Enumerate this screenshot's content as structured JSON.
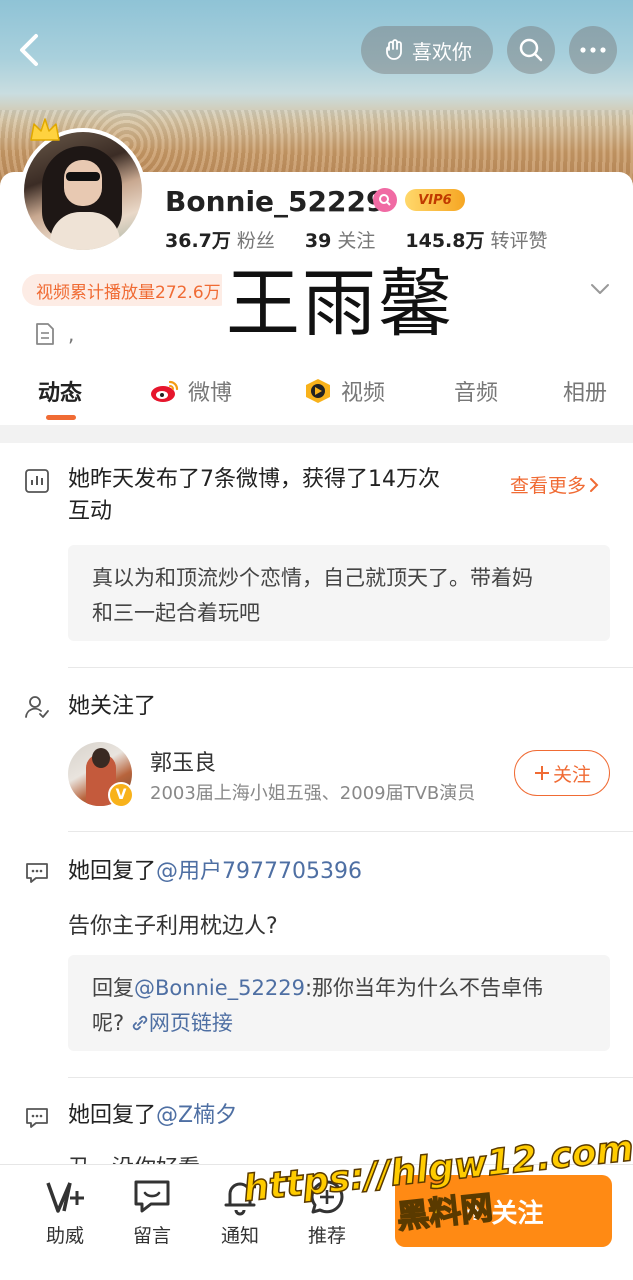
{
  "header": {
    "like_label": "喜欢你"
  },
  "profile": {
    "username": "Bonnie_52229",
    "vip_label": "VIP6",
    "stats": [
      {
        "num": "36.7万",
        "label": "粉丝"
      },
      {
        "num": "39",
        "label": "关注"
      },
      {
        "num": "145.8万",
        "label": "转评赞"
      }
    ],
    "tag": "视频累计播放量272.6万",
    "overlay_name": "王雨馨",
    "bio": ","
  },
  "tabs": [
    {
      "label": "动态",
      "active": true
    },
    {
      "label": "微博",
      "active": false
    },
    {
      "label": "视频",
      "active": false
    },
    {
      "label": "音频",
      "active": false
    },
    {
      "label": "相册",
      "active": false
    }
  ],
  "feed": {
    "summary": {
      "title_line1": "她昨天发布了7条微博，获得了14万次",
      "title_line2": "互动",
      "more_label": "查看更多",
      "quote_line1": "真以为和顶流炒个恋情，自己就顶天了。带着妈",
      "quote_line2": "和三一起合着玩吧"
    },
    "follow": {
      "title": "她关注了",
      "name": "郭玉良",
      "desc": "2003届上海小姐五强、2009届TVB演员",
      "verified_mark": "V",
      "button_label": "关注"
    },
    "reply1": {
      "prefix": "她回复了",
      "mention": "@用户7977705396",
      "text": "告你主子利用枕边人?",
      "quote_prefix": "回复",
      "quote_mention": "@Bonnie_52229",
      "quote_line1": ":那你当年为什么不告卓伟",
      "quote_line2_text": "呢?",
      "link_label": "网页链接"
    },
    "reply2": {
      "prefix": "她回复了",
      "mention": "@Z楠夕",
      "text_partial": "丑，没你好看"
    }
  },
  "bottom_nav": [
    {
      "label": "助威",
      "icon": "cheer-icon"
    },
    {
      "label": "留言",
      "icon": "message-icon"
    },
    {
      "label": "通知",
      "icon": "bell-icon"
    },
    {
      "label": "推荐",
      "icon": "recommend-icon"
    }
  ],
  "bottom_follow_label": "关注",
  "watermark": {
    "url": "https://hlgw12.com",
    "text": "黑料网"
  },
  "colors": {
    "accent": "#f06b34",
    "link": "#4e6fa3",
    "follow_button": "#ff8a14"
  }
}
